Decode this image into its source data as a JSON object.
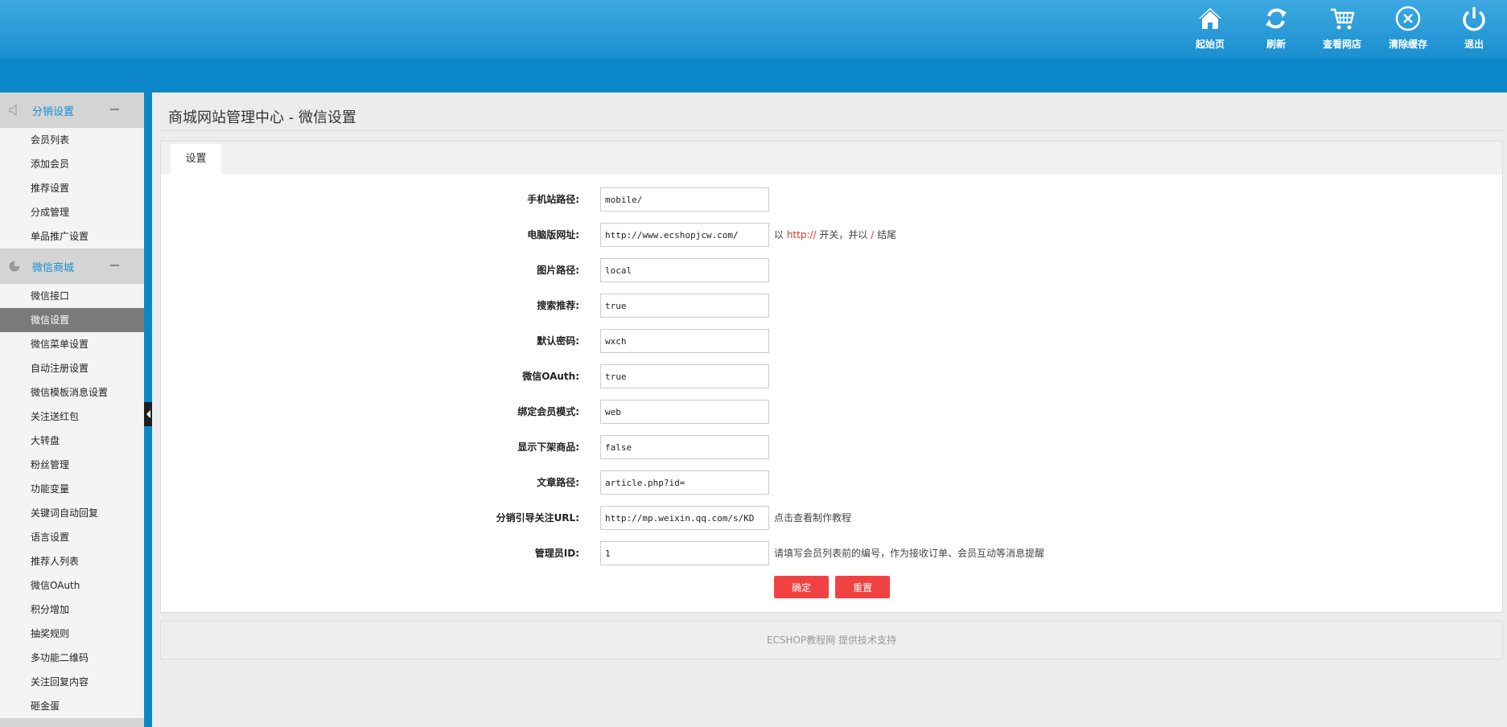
{
  "header": {
    "actions": [
      {
        "label": "起始页",
        "icon": "home-icon"
      },
      {
        "label": "刷新",
        "icon": "refresh-icon"
      },
      {
        "label": "查看网店",
        "icon": "cart-icon"
      },
      {
        "label": "清除缓存",
        "icon": "close-circle-icon"
      },
      {
        "label": "退出",
        "icon": "power-icon"
      }
    ]
  },
  "sidebar": {
    "groups": [
      {
        "title": "分销设置",
        "icon": "speaker-icon",
        "items": [
          "会员列表",
          "添加会员",
          "推荐设置",
          "分成管理",
          "单品推广设置"
        ]
      },
      {
        "title": "微信商城",
        "icon": "pie-chart-icon",
        "items": [
          "微信接口",
          "微信设置",
          "微信菜单设置",
          "自动注册设置",
          "微信模板消息设置",
          "关注送红包",
          "大转盘",
          "粉丝管理",
          "功能变量",
          "关键词自动回复",
          "语言设置",
          "推荐人列表",
          "微信OAuth",
          "积分增加",
          "抽奖规则",
          "多功能二维码",
          "关注回复内容",
          "砸金蛋"
        ]
      }
    ],
    "active_item": "微信设置"
  },
  "page": {
    "title": "商城网站管理中心 - 微信设置",
    "tab": "设置"
  },
  "form": {
    "fields": [
      {
        "label": "手机站路径:",
        "value": "mobile/",
        "note": ""
      },
      {
        "label": "电脑版网址:",
        "value": "http://www.ecshopjcw.com/",
        "note_parts": [
          "以 ",
          "http://",
          " 开关，并以 ",
          "/",
          " 结尾"
        ]
      },
      {
        "label": "图片路径:",
        "value": "local",
        "note": ""
      },
      {
        "label": "搜索推荐:",
        "value": "true",
        "note": ""
      },
      {
        "label": "默认密码:",
        "value": "wxch",
        "note": ""
      },
      {
        "label": "微信OAuth:",
        "value": "true",
        "note": ""
      },
      {
        "label": "绑定会员模式:",
        "value": "web",
        "note": ""
      },
      {
        "label": "显示下架商品:",
        "value": "false",
        "note": ""
      },
      {
        "label": "文章路径:",
        "value": "article.php?id=",
        "note": ""
      },
      {
        "label": "分销引导关注URL:",
        "value": "http://mp.weixin.qq.com/s/KD",
        "note": "点击查看制作教程"
      },
      {
        "label": "管理员ID:",
        "value": "1",
        "note": "请填写会员列表前的编号，作为接收订单、会员互动等消息提醒"
      }
    ],
    "submit_label": "确定",
    "reset_label": "重置"
  },
  "footer": {
    "text": "ECSHOP教程网 提供技术支持"
  },
  "colors": {
    "header_blue": "#1a8fd0",
    "accent_red": "#f14242"
  }
}
